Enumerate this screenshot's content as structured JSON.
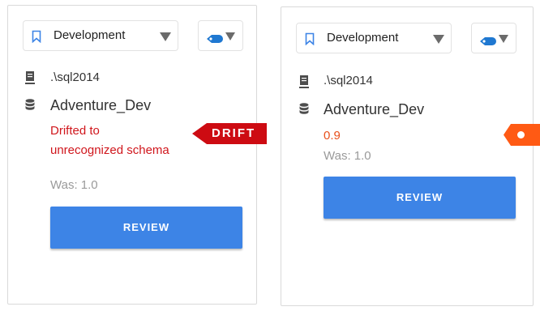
{
  "cards": [
    {
      "environment": "Development",
      "server": ".\\sql2014",
      "database": "Adventure_Dev",
      "status_message": "Drifted to unrecognized schema",
      "status_line1": "Drifted to",
      "status_line2": "unrecognized schema",
      "was": "Was: 1.0",
      "review_label": "REVIEW",
      "flag_label": "DRIFT"
    },
    {
      "environment": "Development",
      "server": ".\\sql2014",
      "database": "Adventure_Dev",
      "version": "0.9",
      "was": "Was: 1.0",
      "review_label": "REVIEW"
    }
  ],
  "colors": {
    "bookmark": "#3d84e6",
    "tag": "#1f78d1",
    "drift_red": "#cd0b12",
    "drift_orange": "#ff5a14",
    "review_button": "#3d84e6"
  },
  "icons": {
    "environment": "bookmark-icon",
    "tags": "tag-icon",
    "server": "server-icon",
    "database": "database-icon"
  }
}
